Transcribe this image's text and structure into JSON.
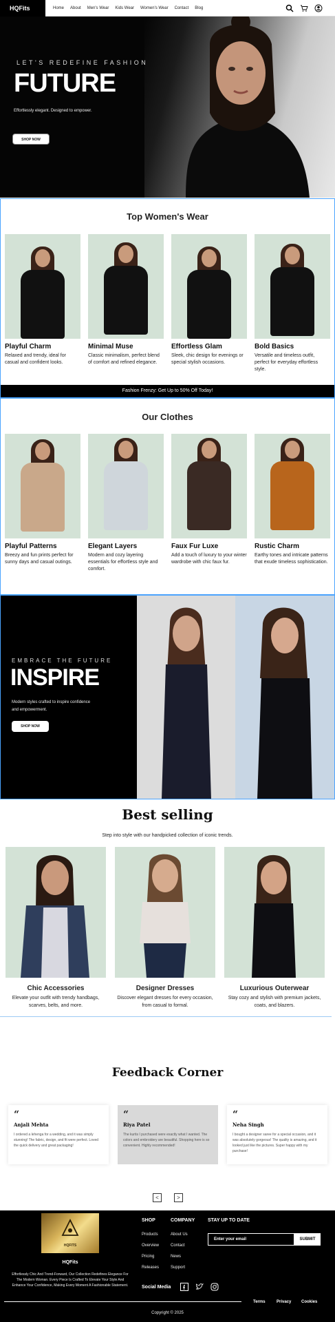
{
  "nav": {
    "brand": "HQFits",
    "links": [
      "Home",
      "About",
      "Men's Wear",
      "Kids Wear",
      "Women's Wear",
      "Contact",
      "Blog"
    ]
  },
  "hero": {
    "eyebrow": "LET'S REDEFINE FASHION",
    "title": "FUTURE",
    "subtitle": "Effortlessly elegant. Designed to empower.",
    "button": "SHOP NOW"
  },
  "top_womens": {
    "title": "Top Women's Wear",
    "items": [
      {
        "name": "Playful Charm",
        "desc": "Relaxed and trendy, ideal for casual and confident looks."
      },
      {
        "name": "Minimal Muse",
        "desc": "Classic minimalism, perfect blend of comfort and refined elegance."
      },
      {
        "name": "Effortless Glam",
        "desc": "Sleek, chic design for evenings or special stylish occasions."
      },
      {
        "name": "Bold Basics",
        "desc": "Versatile and timeless outfit, perfect for everyday effortless style."
      }
    ]
  },
  "banner": "Fashion Frenzy: Get Up to 50% Off Today!",
  "our_clothes": {
    "title": "Our Clothes",
    "items": [
      {
        "name": "Playful Patterns",
        "desc": "Breezy and fun prints perfect for sunny days and casual outings."
      },
      {
        "name": "Elegant Layers",
        "desc": "Modern and cozy layering essentials for effortless style and comfort."
      },
      {
        "name": "Faux Fur Luxe",
        "desc": "Add a touch of luxury to your winter wardrobe with chic faux fur."
      },
      {
        "name": "Rustic Charm",
        "desc": "Earthy tones and intricate patterns that exude timeless sophistication."
      }
    ]
  },
  "inspire": {
    "eyebrow": "EMBRACE THE FUTURE",
    "title": "INSPIRE",
    "subtitle": "Modern styles crafted to inspire confidence and empowerment.",
    "button": "SHOP NOW"
  },
  "best_selling": {
    "title": "Best selling",
    "subtitle": "Step into style with our handpicked collection of iconic trends.",
    "items": [
      {
        "name": "Chic Accessories",
        "desc": "Elevate your outfit with trendy handbags, scarves, belts, and more."
      },
      {
        "name": "Designer Dresses",
        "desc": "Discover elegant dresses for every occasion, from casual to formal."
      },
      {
        "name": "Luxurious Outerwear",
        "desc": "Stay cozy and stylish with premium jackets, coats, and blazers."
      }
    ]
  },
  "feedback": {
    "title": "Feedback Corner",
    "quote_mark": "“",
    "items": [
      {
        "name": "Anjali Mehta",
        "text": "I ordered a lehenga for a wedding, and it was simply stunning! The fabric, design, and fit were perfect. Loved the quick delivery and great packaging!"
      },
      {
        "name": "Riya Patel",
        "text": "The kurtis I purchased were exactly what I wanted. The colors and embroidery are beautiful. Shopping here is so convenient. Highly recommended!"
      },
      {
        "name": "Neha Singh",
        "text": "I bought a designer saree for a special occasion, and it was absolutely gorgeous! The quality is amazing, and it looked just like the pictures. Super happy with my purchase!"
      }
    ],
    "prev": "<",
    "next": ">"
  },
  "footer": {
    "logo_text": "HQFITS",
    "brand": "HQFits",
    "description": "Effortlessly Chic And Trend-Forward, Our Collection Redefines Elegance For The Modern Woman. Every Piece Is Crafted To Elevate Your Style And Enhance Your Confidence, Making Every Moment A Fashionable Statement.",
    "shop_heading": "SHOP",
    "shop_links": [
      "Products",
      "Overview",
      "Pricing",
      "Releases"
    ],
    "company_heading": "COMPANY",
    "company_links": [
      "About Us",
      "Contact",
      "News",
      "Support"
    ],
    "newsletter_heading": "STAY UP TO DATE",
    "email_placeholder": "Enter your email",
    "submit": "SUBMIT",
    "social_label": "Social Media",
    "legal": [
      "Terms",
      "Privacy",
      "Cookies"
    ],
    "copyright": "Copyright © 2025"
  },
  "colors": {
    "card_bg": "#d3e2d6",
    "accent_border": "#4aa3ff",
    "footer_bg": "#000000",
    "gold": "#d8b45a"
  }
}
